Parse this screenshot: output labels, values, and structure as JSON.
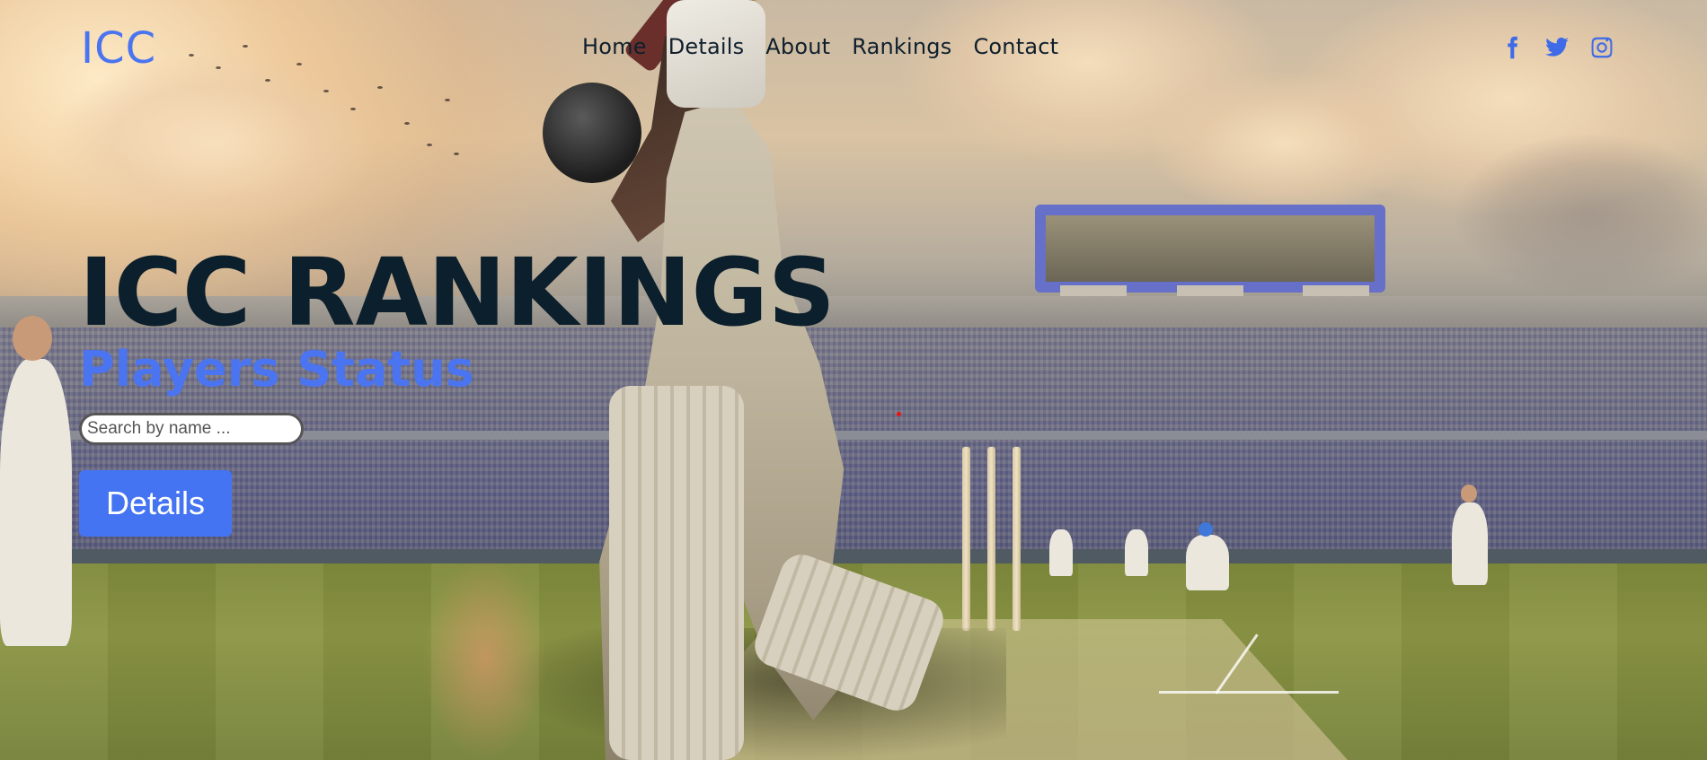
{
  "brand": {
    "logo_text": "ICC"
  },
  "nav": {
    "items": [
      {
        "label": "Home"
      },
      {
        "label": "Details"
      },
      {
        "label": "About"
      },
      {
        "label": "Rankings"
      },
      {
        "label": "Contact"
      }
    ]
  },
  "social": {
    "icons": [
      "facebook-icon",
      "twitter-icon",
      "instagram-icon"
    ]
  },
  "hero": {
    "title": "ICC RANKINGS",
    "subtitle": "Players Status",
    "search": {
      "placeholder": "Search by name ...",
      "value": ""
    },
    "button_label": "Details"
  },
  "colors": {
    "accent": "#4474f2",
    "title": "#0c1f2c",
    "nav_text": "#0f1f2c"
  }
}
